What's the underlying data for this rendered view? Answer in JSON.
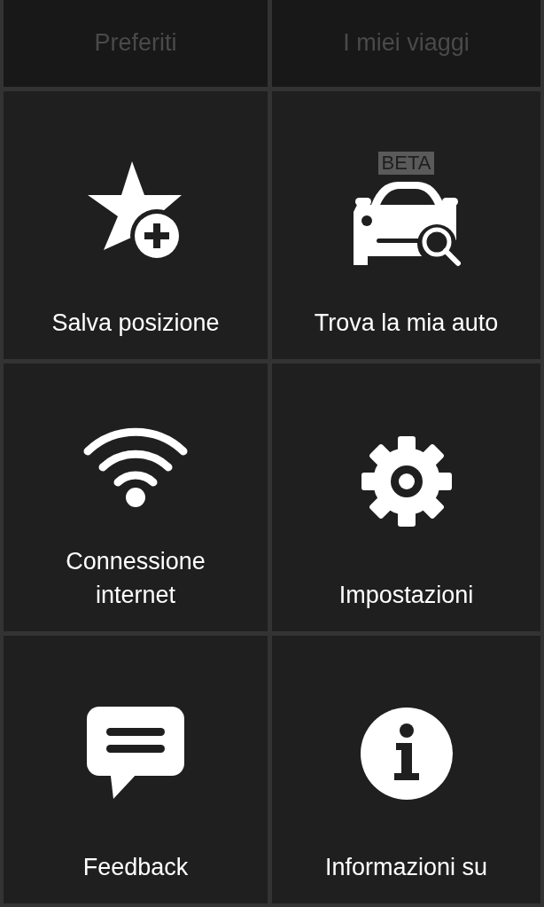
{
  "tabs": [
    {
      "label": "Preferiti",
      "disabled": true
    },
    {
      "label": "I miei viaggi",
      "disabled": true
    }
  ],
  "tiles": [
    {
      "label": "Salva posizione",
      "kind": "star-plus"
    },
    {
      "label": "Trova la mia auto",
      "kind": "car-search"
    },
    {
      "label": "Connessione\ninternet",
      "kind": "wifi"
    },
    {
      "label": "Impostazioni",
      "kind": "gear"
    },
    {
      "label": "Feedback",
      "kind": "chat"
    },
    {
      "label": "Informazioni su",
      "kind": "info"
    }
  ],
  "car_badge": "BETA"
}
